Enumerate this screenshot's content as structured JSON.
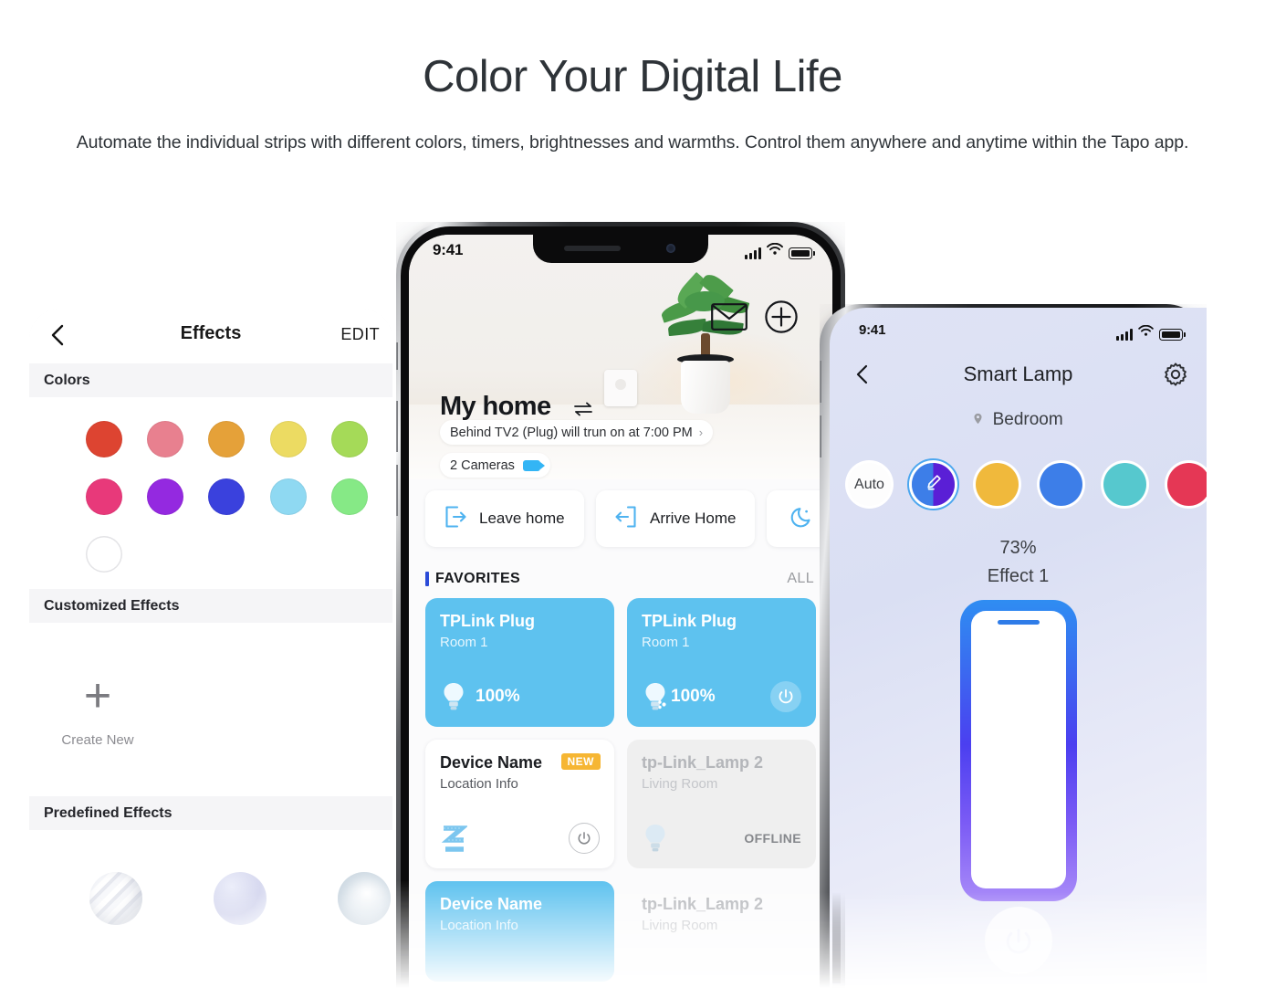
{
  "hero": {
    "title": "Color Your Digital Life",
    "subtitle": "Automate the individual strips with different colors, timers, brightnesses and warmths. Control them anywhere and anytime within the Tapo app."
  },
  "left_phone": {
    "navbar": {
      "back_icon": "chevron-left-icon",
      "title": "Effects",
      "edit_label": "EDIT"
    },
    "sections": {
      "colors": "Colors",
      "customized_effects": "Customized Effects",
      "predefined_effects": "Predefined Effects"
    },
    "colors": [
      {
        "name": "red",
        "hex": "#dd4431"
      },
      {
        "name": "pink",
        "hex": "#e8808f"
      },
      {
        "name": "orange",
        "hex": "#e5a139"
      },
      {
        "name": "yellow",
        "hex": "#ecdb62"
      },
      {
        "name": "lime",
        "hex": "#a5da58"
      },
      {
        "name": "magenta",
        "hex": "#e8397a"
      },
      {
        "name": "purple",
        "hex": "#9429e0"
      },
      {
        "name": "blue",
        "hex": "#3a41dd"
      },
      {
        "name": "sky",
        "hex": "#8fd9f2"
      },
      {
        "name": "green",
        "hex": "#86e986"
      },
      {
        "name": "white",
        "hex": "#ffffff"
      }
    ],
    "create_new": {
      "icon": "plus-icon",
      "label": "Create New"
    },
    "predefined": [
      {
        "name": "effect-orb-1"
      },
      {
        "name": "effect-orb-2"
      },
      {
        "name": "effect-orb-3"
      }
    ]
  },
  "center_phone": {
    "status_bar": {
      "time": "9:41",
      "signal_icon": "cellular-bars-icon",
      "wifi_icon": "wifi-icon",
      "battery_icon": "battery-full-icon"
    },
    "header": {
      "title": "My home",
      "swap_icon": "swap-arrows-icon",
      "message_icon": "envelope-icon",
      "add_icon": "plus-circle-icon",
      "notification": "Behind TV2 (Plug) will trun on at 7:00 PM",
      "notification_chevron": "chevron-right-icon",
      "cameras": "2 Cameras",
      "camera_icon": "video-camera-icon"
    },
    "scenes": [
      {
        "label": "Leave home",
        "icon": "leave-home-icon"
      },
      {
        "label": "Arrive Home",
        "icon": "arrive-home-icon"
      },
      {
        "label": "",
        "icon": "moon-icon"
      }
    ],
    "favorites": {
      "title": "FAVORITES",
      "all_label": "ALL"
    },
    "devices": [
      {
        "name": "TPLink Plug",
        "location": "Room 1",
        "value": "100%",
        "state": "on",
        "icon": "bulb-icon",
        "power_icon": "power-icon",
        "badge": "",
        "status": ""
      },
      {
        "name": "TPLink Plug",
        "location": "Room 1",
        "value": "100%",
        "state": "on",
        "icon": "bulb-share-icon",
        "power_icon": "power-icon",
        "badge": "",
        "status": ""
      },
      {
        "name": "Device Name",
        "location": "Location Info",
        "value": "",
        "state": "white",
        "icon": "light-strip-icon",
        "power_icon": "power-icon",
        "badge": "NEW",
        "status": ""
      },
      {
        "name": "tp-Link_Lamp 2",
        "location": "Living Room",
        "value": "",
        "state": "offline",
        "icon": "bulb-icon",
        "power_icon": "",
        "badge": "",
        "status": "OFFLINE"
      },
      {
        "name": "Device Name",
        "location": "Location Info",
        "value": "",
        "state": "on",
        "icon": "",
        "power_icon": "",
        "badge": "",
        "status": ""
      },
      {
        "name": "tp-Link_Lamp 2",
        "location": "Living Room",
        "value": "",
        "state": "offline",
        "icon": "",
        "power_icon": "",
        "badge": "",
        "status": ""
      }
    ]
  },
  "right_phone": {
    "status_bar": {
      "time": "9:41",
      "signal_icon": "cellular-bars-icon",
      "wifi_icon": "wifi-icon",
      "battery_icon": "battery-full-icon"
    },
    "navbar": {
      "back_icon": "chevron-left-icon",
      "title": "Smart Lamp",
      "settings_icon": "gear-icon"
    },
    "room": {
      "label": "Bedroom",
      "pin_icon": "location-pin-icon"
    },
    "color_presets": [
      {
        "name": "auto",
        "label": "Auto",
        "hex": "#fdfdfd"
      },
      {
        "name": "custom-edit",
        "label": "",
        "hex": "#5a1fd6",
        "icon": "pencil-icon",
        "selected": true
      },
      {
        "name": "amber",
        "label": "",
        "hex": "#f0b93c"
      },
      {
        "name": "blue",
        "label": "",
        "hex": "#3d7ee8"
      },
      {
        "name": "teal",
        "label": "",
        "hex": "#56c8ce"
      },
      {
        "name": "red",
        "label": "",
        "hex": "#e53755"
      }
    ],
    "brightness": "73%",
    "effect": "Effect 1",
    "lamp": {
      "icon": "light-strip-visual"
    },
    "power_icon": "power-icon"
  }
}
